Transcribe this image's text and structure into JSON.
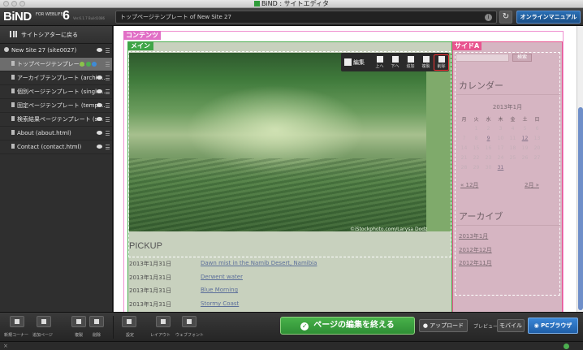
{
  "window": {
    "title": "BiND : サイトエディタ"
  },
  "header": {
    "logo": "BiND",
    "logo_sub": "FOR WEBLIFE",
    "logo_version_num": "6",
    "version": "Ver.6.1.7 Build1086",
    "url_text": "トップページテンプレート of New Site 27",
    "info_icon": "i",
    "reload_icon": "↻",
    "manual_label": "オンラインマニュアル"
  },
  "sidebar": {
    "back_label": "サイトシアターに戻る",
    "site": "New Site 27 (site0027)",
    "pages": [
      {
        "label": "トップページテンプレー..."
      },
      {
        "label": "アーカイブテンプレート (archiv..."
      },
      {
        "label": "個別ページテンプレート (single..."
      },
      {
        "label": "固定ページテンプレート (templ..."
      },
      {
        "label": "検索結果ページテンプレート (s..."
      },
      {
        "label": "About (about.html)"
      },
      {
        "label": "Contact (contact.html)"
      }
    ],
    "badge_colors": [
      "#8bc34a",
      "#4caf50",
      "#3f8bd6"
    ]
  },
  "canvas": {
    "contents_label": "コンテンツ",
    "main_label": "メイン",
    "side_label": "サイドA",
    "block_toolbar": {
      "edit": "編集",
      "up": "上へ",
      "down": "下へ",
      "add": "追加",
      "copy": "複製",
      "delete": "削除"
    },
    "photo_credit": "©iStockphoto.com/Larysa Dodz",
    "pickup": {
      "title": "PICKUP",
      "rows": [
        {
          "date": "2013年1月31日",
          "title": "Dawn mist in the Namib Desert, Namibia"
        },
        {
          "date": "2013年1月31日",
          "title": "Derwent water"
        },
        {
          "date": "2013年1月31日",
          "title": "Blue Morning"
        },
        {
          "date": "2013年1月31日",
          "title": "Stormy Coast"
        }
      ]
    },
    "side": {
      "search_btn": "検索",
      "calendar_title": "カレンダー",
      "month": "2013年1月",
      "weekdays": [
        "月",
        "火",
        "水",
        "木",
        "金",
        "土",
        "日"
      ],
      "weeks": [
        [
          "",
          "1",
          "2",
          "3",
          "4",
          "5",
          "6"
        ],
        [
          "7",
          "8",
          "9",
          "10",
          "11",
          "12",
          "13"
        ],
        [
          "14",
          "15",
          "16",
          "17",
          "18",
          "19",
          "20"
        ],
        [
          "21",
          "22",
          "23",
          "24",
          "25",
          "26",
          "27"
        ],
        [
          "28",
          "29",
          "30",
          "31",
          "",
          "",
          ""
        ]
      ],
      "prev": "« 12月",
      "next": "2月 »",
      "archive_title": "アーカイブ",
      "archives": [
        "2013年1月",
        "2012年12月",
        "2012年11月"
      ]
    }
  },
  "bottom": {
    "left_buttons": [
      "新規コーナー",
      "追加ページ",
      "複製",
      "削除"
    ],
    "mid_buttons": [
      "設定",
      "レイアウト",
      "ウェブフォント"
    ],
    "finish_label": "ページの編集を終える",
    "upload_label": "アップロード",
    "preview_label": "プレビュー",
    "mobile_label": "モバイル",
    "pc_label": "PCブラウザ"
  },
  "status": {
    "left": "×"
  }
}
